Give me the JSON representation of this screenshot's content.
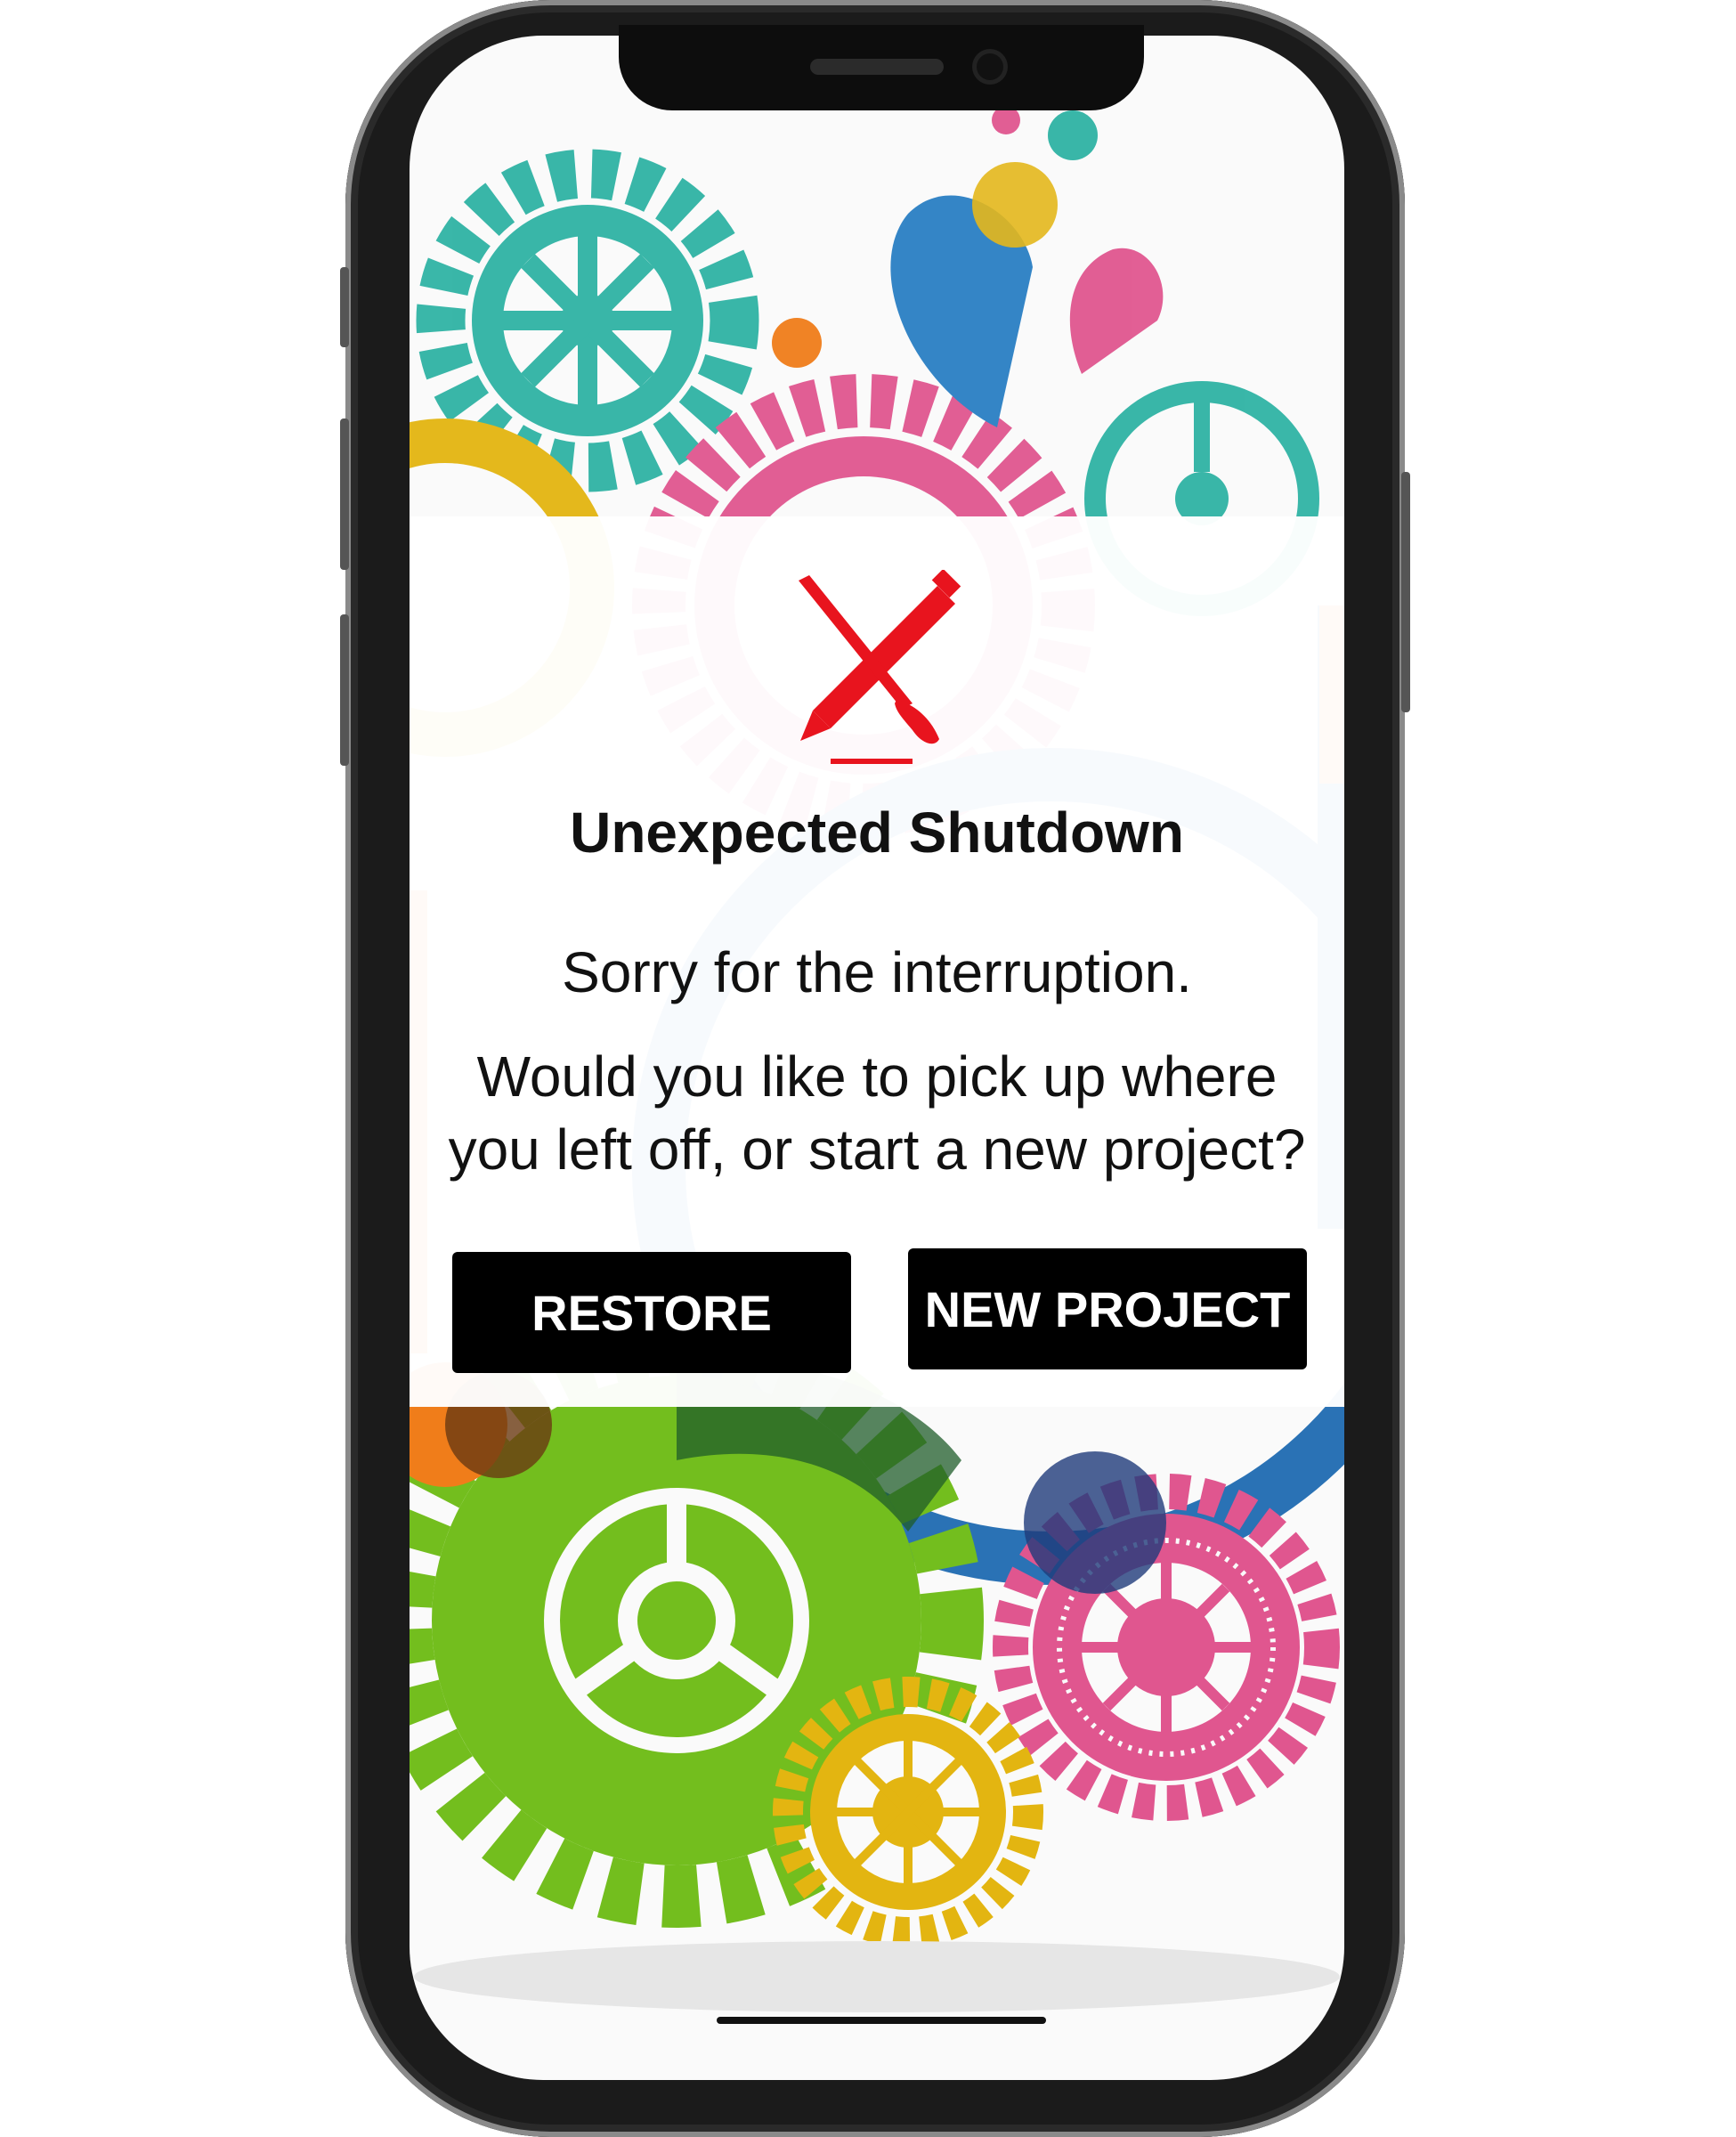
{
  "dialog": {
    "title": "Unexpected Shutdown",
    "message_line1": "Sorry for the interruption.",
    "message_line2": "Would you like to pick up where you left off, or start a new project?",
    "icon": "crossed-pencil-brush-icon",
    "restore_label": "RESTORE",
    "new_project_label": "NEW PROJECT"
  },
  "colors": {
    "icon_red": "#e8141e",
    "button_bg": "#000000",
    "button_text": "#ffffff"
  }
}
